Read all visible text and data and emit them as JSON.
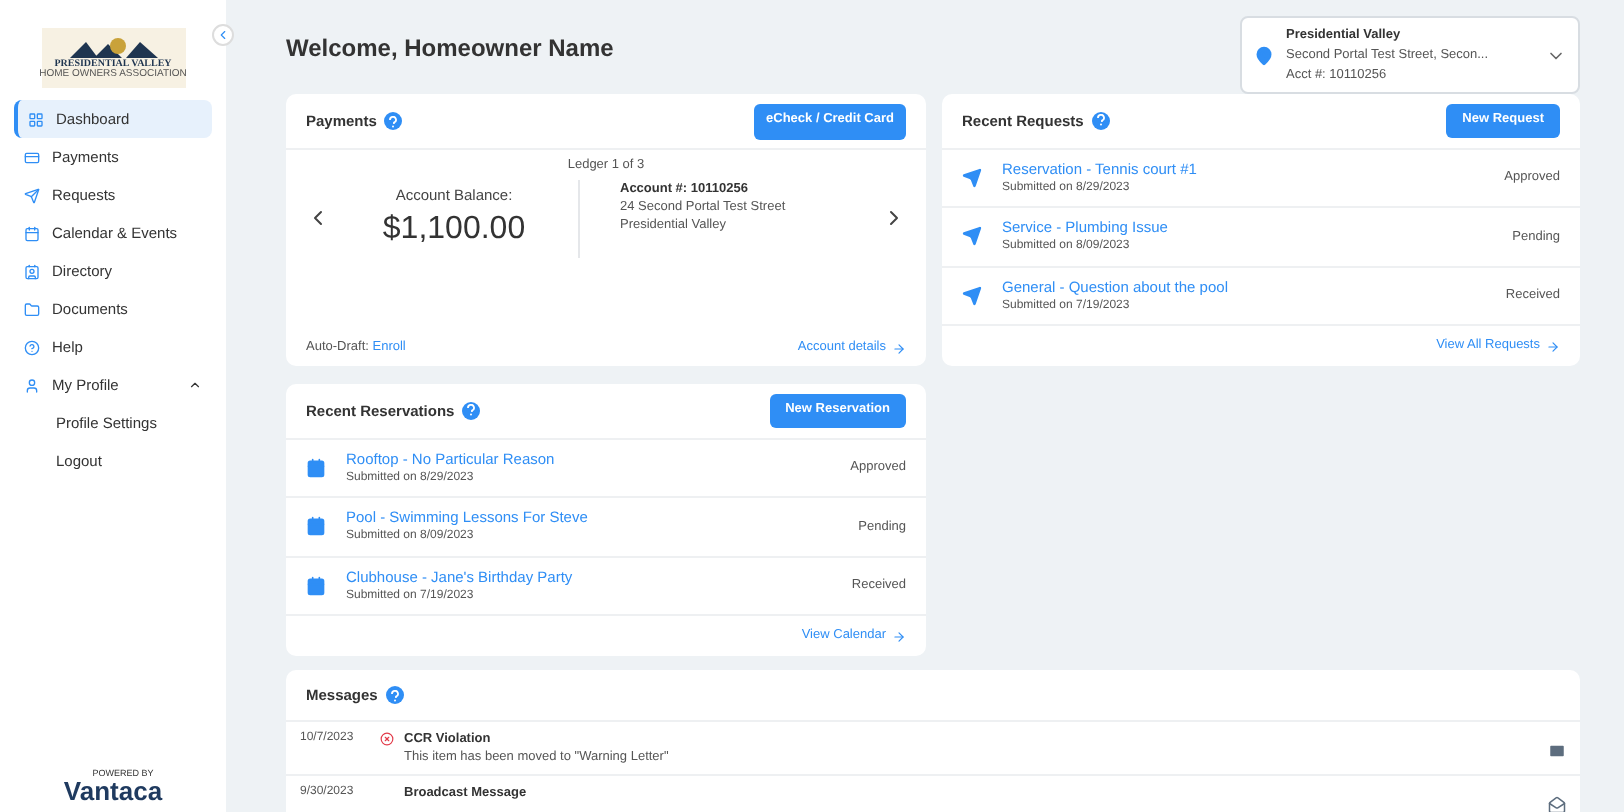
{
  "sidebar": {
    "logo": {
      "title": "PRESIDENTIAL VALLEY",
      "subtitle": "HOME OWNERS ASSOCIATION"
    },
    "items": [
      {
        "label": "Dashboard",
        "kind": "grid",
        "selected": true
      },
      {
        "label": "Payments",
        "kind": "card",
        "selected": false
      },
      {
        "label": "Requests",
        "kind": "plane",
        "selected": false
      },
      {
        "label": "Calendar & Events",
        "kind": "calendar",
        "selected": false
      },
      {
        "label": "Directory",
        "kind": "contact",
        "selected": false
      },
      {
        "label": "Documents",
        "kind": "folder",
        "selected": false
      },
      {
        "label": "Help",
        "kind": "help",
        "selected": false
      },
      {
        "label": "My Profile",
        "kind": "user",
        "selected": false,
        "expanded": true,
        "children": [
          {
            "label": "Profile Settings",
            "selected": false
          },
          {
            "label": "Logout",
            "selected": false
          }
        ]
      }
    ],
    "footer": {
      "powered": "POWERED BY",
      "brand": "Vantaca"
    }
  },
  "header": {
    "title": "Welcome, Homeowner Name"
  },
  "location": {
    "name": "Presidential Valley",
    "address": "Second Portal Test Street, Secon...",
    "account": "Acct #: 10110256"
  },
  "payments": {
    "title": "Payments",
    "button": "eCheck / Credit Card",
    "ledger": "Ledger 1 of 3",
    "balance_label": "Account Balance:",
    "balance": "$1,100.00",
    "account": "Account #: 10110256",
    "address_1": "24 Second Portal Test Street",
    "address_2": "Presidential Valley",
    "autodraft_label": "Auto-Draft:",
    "autodraft_link": "Enroll",
    "details_link": "Account details"
  },
  "requests": {
    "title": "Recent Requests",
    "button": "New Request",
    "items": [
      {
        "title": "Reservation - Tennis court #1",
        "submitted": "Submitted on 8/29/2023",
        "status": "Approved"
      },
      {
        "title": "Service - Plumbing Issue",
        "submitted": "Submitted on 8/09/2023",
        "status": "Pending"
      },
      {
        "title": "General - Question about the pool",
        "submitted": "Submitted on 7/19/2023",
        "status": "Received"
      }
    ],
    "link": "View All Requests"
  },
  "reservations": {
    "title": "Recent Reservations",
    "button": "New Reservation",
    "items": [
      {
        "title": "Rooftop - No Particular Reason",
        "submitted": "Submitted on 8/29/2023",
        "status": "Approved"
      },
      {
        "title": "Pool - Swimming Lessons For Steve",
        "submitted": "Submitted on 8/09/2023",
        "status": "Pending"
      },
      {
        "title": "Clubhouse - Jane's Birthday Party",
        "submitted": "Submitted on 7/19/2023",
        "status": "Received"
      }
    ],
    "link": "View Calendar"
  },
  "messages": {
    "title": "Messages",
    "items": [
      {
        "date": "10/7/2023",
        "alert": true,
        "title": "CCR Violation",
        "body": "This item has been moved to \"Warning Letter\"",
        "read": false
      },
      {
        "date": "9/30/2023",
        "alert": false,
        "title": "Broadcast Message",
        "read": true
      }
    ]
  }
}
